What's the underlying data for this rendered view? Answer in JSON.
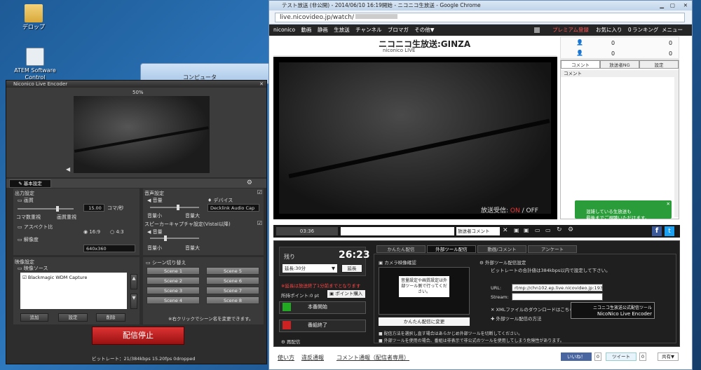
{
  "desktop": {
    "icons": [
      {
        "label": "デロップ"
      },
      {
        "label": "ATEM Software Control"
      }
    ],
    "bg_window_title": "コンピュータ"
  },
  "encoder": {
    "title": "Niconico Live Encoder",
    "preview_zoom": "50%",
    "tab_basic": "基本設定",
    "output": {
      "heading": "出力設定",
      "quality": "画質",
      "fps_value": "15.00",
      "fps_unit": "コマ/秒",
      "frames_priority": "コマ数重視",
      "quality_priority": "画質重視",
      "aspect": "アスペクト比",
      "aspect_169": "16:9",
      "aspect_43": "4:3",
      "resolution": "解像度",
      "resolution_value": "640x360"
    },
    "audio": {
      "heading": "音声設定",
      "volume": "音量",
      "device": "デバイス",
      "device_value": "Decklink Audio Cap",
      "vol_low": "音量小",
      "vol_high": "音量大",
      "speaker": "スピーカーキャプチャ設定(VistaI以降)",
      "volume2": "音量",
      "vol_low2": "音量小",
      "vol_high2": "音量大"
    },
    "video": {
      "heading": "映像設定",
      "source": "映像ソース",
      "source_item": "Blackmagic WDM Capture",
      "add": "追加",
      "settings": "設定",
      "delete": "削除"
    },
    "scene": {
      "heading": "シーン切り替え",
      "buttons": [
        "Scene 1",
        "Scene 5",
        "Scene 2",
        "Scene 6",
        "Scene 3",
        "Scene 7",
        "Scene 4",
        "Scene 8"
      ],
      "note": "※右クリックでシーン名を変更できます。"
    },
    "stop_button": "配信停止",
    "status": "ビットレート：21/384kbps 15.20fps 0dropped"
  },
  "chrome": {
    "title": "テスト放送 (非公開) - 2014/06/10 16:19開始 - ニコニコ生放送 - Google Chrome",
    "url": "live.nicovideo.jp/watch/",
    "nav": [
      "niconico",
      "動画",
      "静画",
      "生放送",
      "チャンネル",
      "ブロマガ",
      "その他▼"
    ],
    "nav_right": {
      "premium": "プレミアム登録",
      "favorites": "お気に入り",
      "fav_count": "0",
      "ranking": "ランキング",
      "menu": "メニュー"
    },
    "banner": "ニコニコ生放送:GINZA",
    "banner_sub": "niconico LIVE",
    "counts": [
      "0",
      "0",
      "0",
      "0"
    ],
    "comment_tabs": [
      "コメント",
      "放送者NG",
      "設定"
    ],
    "comment_header": "コメント",
    "video_overlay": {
      "label": "放送受信:",
      "on": "ON",
      "sep": "/",
      "off": "OFF"
    },
    "player": {
      "time": "03:36",
      "comment_mode": "放送者コメント"
    },
    "toast": "混雑している生放送も\n最後までご視聴いただけます。",
    "dash": {
      "remaining": "残り",
      "remaining_time": "26:23",
      "extend": "延長:30分",
      "extend_btn": "延長",
      "warning": "※延長は放送終了1分前までとなります",
      "points": "所持ポイント:0 pt",
      "buy": "ポイント購入",
      "start": "本番開始",
      "end": "番組終了",
      "redeliver": "再配信",
      "tabs": [
        "かんたん配信",
        "外部ツール配信",
        "動画/コメント",
        "アンケート"
      ],
      "camera": "カメラ映像確認",
      "camera_note": "音量設定や画質設定は外部ツール側で行ってください。",
      "easy_change": "かんたん配信に変更",
      "ext_heading": "外部ツール配信設定",
      "bitrate_note": "ビットレートの合計値は384kbps以内で設定して下さい。",
      "url_label": "URL:",
      "url_value": "rtmp://chn102.ep.live.nicovideo.jp:193",
      "stream_label": "Stream:",
      "xml_dl": "XMLファイルのダウンロードはこちら",
      "ext_howto": "外部ツール配信の方法",
      "tool_banner_1": "ニコニコ生放送公式配信ツール",
      "tool_banner_2": "NicoNico Live Encoder",
      "note1": "■ 配信方法を選択し直す場合はあらかじめ外部ツールを切断してください。",
      "note2": "■ 外部ツールを使用の場合、番組は非表示で非公式のツールを使用してしまう危険性があります。"
    },
    "footer": {
      "links": [
        "使い方",
        "違反通報",
        "コメント通報（配信者専用）"
      ],
      "like": "いいね！",
      "like_count": "0",
      "tweet": "ツイート",
      "tweet_count": "0",
      "share": "共有▼"
    }
  }
}
